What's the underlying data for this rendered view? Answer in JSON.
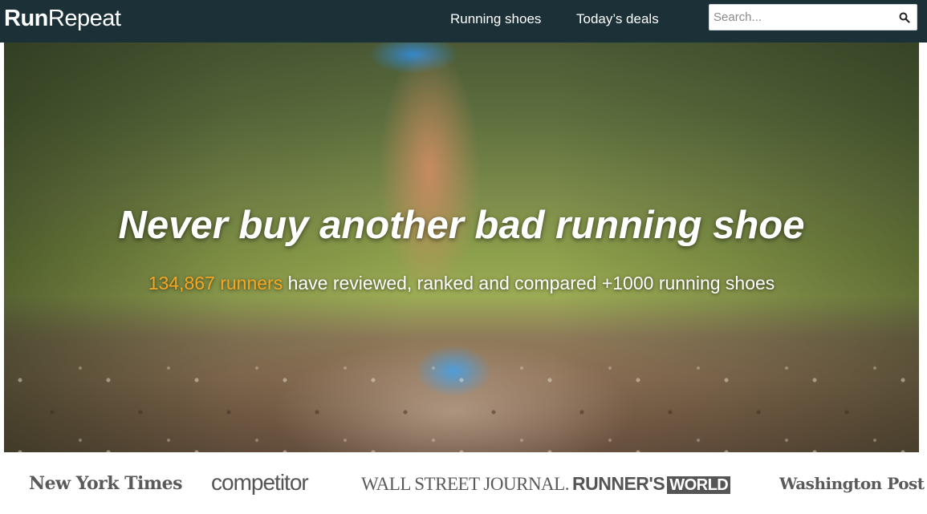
{
  "header": {
    "logo_run": "Run",
    "logo_repeat": "Repeat",
    "nav": {
      "running_shoes": "Running shoes",
      "todays_deals": "Today’s deals"
    },
    "search": {
      "placeholder": "Search...",
      "value": "",
      "icon": "search-icon"
    },
    "background_color": "#1c3038"
  },
  "hero": {
    "title": "Never buy another bad running shoe",
    "subtitle_count": "134,867 runners",
    "subtitle_rest": " have reviewed, ranked and compared +1000 running shoes",
    "accent_color": "#f5a623"
  },
  "press": {
    "nyt": "New York Times",
    "competitor": "competitor",
    "wsj": "WALL STREET JOURNAL.",
    "runners_world_a": "RUNNER'S",
    "runners_world_b": "WORLD",
    "washington_post": "Washington Post"
  }
}
